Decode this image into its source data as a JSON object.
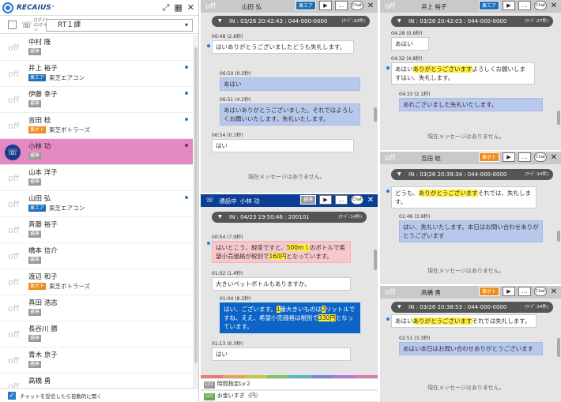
{
  "app": {
    "logo": "RECAIUS",
    "tm": "™"
  },
  "toolbar_icons": [
    "export-icon",
    "grid-icon",
    "close-icon"
  ],
  "filter": {
    "login_label": "ログイン\n/ログイン",
    "group": "RT１課"
  },
  "operators": [
    {
      "status": "off",
      "name": "中村 隆",
      "badge": "標準",
      "badge_color": "gray",
      "company": "",
      "dot": false
    },
    {
      "status": "off",
      "name": "井上 裕子",
      "badge": "東エア",
      "badge_color": "blue",
      "company": "東芝エアコン",
      "dot": true
    },
    {
      "status": "off",
      "name": "伊藤 幸子",
      "badge": "標準",
      "badge_color": "gray",
      "company": "",
      "dot": true
    },
    {
      "status": "off",
      "name": "吉田 稔",
      "badge": "東ボト",
      "badge_color": "orange",
      "company": "東芝ボトラーズ",
      "dot": true
    },
    {
      "status": "call",
      "name": "小林 功",
      "badge": "標準",
      "badge_color": "gray",
      "company": "",
      "dot": true,
      "selected": true
    },
    {
      "status": "off",
      "name": "山本 洋子",
      "badge": "標準",
      "badge_color": "gray",
      "company": "",
      "dot": false
    },
    {
      "status": "off",
      "name": "山田 弘",
      "badge": "東エア",
      "badge_color": "blue",
      "company": "東芝エアコン",
      "dot": true
    },
    {
      "status": "off",
      "name": "斉藤 裕子",
      "badge": "標準",
      "badge_color": "gray",
      "company": "",
      "dot": false
    },
    {
      "status": "off",
      "name": "橋本 信介",
      "badge": "標準",
      "badge_color": "gray",
      "company": "",
      "dot": false
    },
    {
      "status": "off",
      "name": "渡辺 和子",
      "badge": "東ボト",
      "badge_color": "orange",
      "company": "東芝ボトラーズ",
      "dot": false
    },
    {
      "status": "off",
      "name": "真田 浩志",
      "badge": "標準",
      "badge_color": "gray",
      "company": "",
      "dot": false
    },
    {
      "status": "off",
      "name": "長谷川 勝",
      "badge": "標準",
      "badge_color": "gray",
      "company": "",
      "dot": false
    },
    {
      "status": "off",
      "name": "青木 京子",
      "badge": "標準",
      "badge_color": "gray",
      "company": "",
      "dot": false
    },
    {
      "status": "off",
      "name": "高橋 勇",
      "badge": "",
      "badge_color": "gray",
      "company": "",
      "dot": false
    }
  ],
  "auto_open_label": "チャットを受信したら自動的に開く",
  "panel_common": {
    "off": "off",
    "chat": "Chat",
    "play": "▶",
    "talk": "…",
    "close": "✕",
    "no_msg": "現在メッセージはありません。",
    "tri": "▼"
  },
  "panel_yamada": {
    "name": "山田 弘",
    "badge": "東エア",
    "info": "IN : 03/26 20:42:43 : 044-000-0000",
    "words": "(ﾜｰﾄﾞ:32件)",
    "m1": {
      "t": "06:48 (2.8秒)",
      "text": "はいありがとうございましたどうも失礼します。"
    },
    "m2": {
      "t": "06:50 (0.3秒)",
      "text": "あはい"
    },
    "m3": {
      "t": "06:51 (4.2秒)",
      "text": "あはいありがとうございました。それではよろしくお願いいたします。失礼いたします。"
    },
    "m4": {
      "t": "06:54 (0.1秒)",
      "text": "はい"
    }
  },
  "panel_kobayashi": {
    "state": "通話中",
    "name": "小林 功",
    "badge": "標準",
    "info": "IN : 04/23 19:50:46 : 200101",
    "words": "(ﾜｰﾄﾞ:14件)",
    "m1": {
      "t": "00:54 (7.9秒)",
      "a": "はいとこう、緑茶ですと、",
      "h1": "500ｍｌ",
      "b": "のボトルで希望小売価格が税別で",
      "h2": "160円",
      "c": "となっています。"
    },
    "m2": {
      "t": "01:02 (1.4秒)",
      "text": "大きいペットボトルもありますか。"
    },
    "m3": {
      "t": "01:04 (8.3秒)",
      "a": "はい、ございます。",
      "h1": "1",
      "b": "番大きいものは",
      "h2": "2",
      "c": "リットルですね、ええ、希望小売価格は税別で",
      "h3": "330円",
      "d": "となっています。"
    },
    "m4": {
      "t": "01:13 (0.3秒)",
      "text": "はい"
    },
    "lv1": {
      "lv": "LV2",
      "text": "時間指定Lv２"
    },
    "lv2": {
      "lv": "LV2",
      "text": "お金いすぎ（円）"
    }
  },
  "panel_inoue": {
    "name": "井上 裕子",
    "badge": "東エア",
    "info": "IN : 03/26 20:42:03 : 044-000-0000",
    "words": "(ﾜｰﾄﾞ:27件)",
    "m1": {
      "t": "04:28 (0.8秒)",
      "text": "あはい"
    },
    "m2": {
      "t": "04:32 (4.8秒)",
      "a": "あはい",
      "h": "ありがとうございます",
      "b": "よろしくお願いしますはい、失礼します。"
    },
    "m3": {
      "t": "04:33 (2.1秒)",
      "text": "あれございました失礼いたします。"
    }
  },
  "panel_yoshida": {
    "name": "吉田 稔",
    "badge": "東ボト",
    "info": "IN : 03/26 20:39:34 : 044-000-0000",
    "words": "(ﾜｰﾄﾞ:14件)",
    "m1": {
      "a": "どうも、",
      "h": "ありがとうございます",
      "b": "それでは、失礼します。"
    },
    "m2": {
      "t": "01:46 (3.9秒)",
      "text": "はい、失礼いたします。本日はお問い合わせありがとうございます"
    }
  },
  "panel_takahashi": {
    "name": "高橋 勇",
    "badge": "東ボト",
    "info": "IN : 03/26 20:38:53 : 044-000-0000",
    "words": "(ﾜｰﾄﾞ:34件)",
    "m1": {
      "a": "あはい",
      "h": "ありがとうございます",
      "b": "それでは失礼します。"
    },
    "m2": {
      "t": "02:51 (3.3秒)",
      "text": "あはい本日はお問い合わせありがとうございます"
    }
  },
  "colors": {
    "accent": "#0b3f96",
    "selected_row": "#e48ac3",
    "highlight": "#ffee3a",
    "badge_blue": "#1f6fb8",
    "badge_orange": "#f08c1a"
  }
}
